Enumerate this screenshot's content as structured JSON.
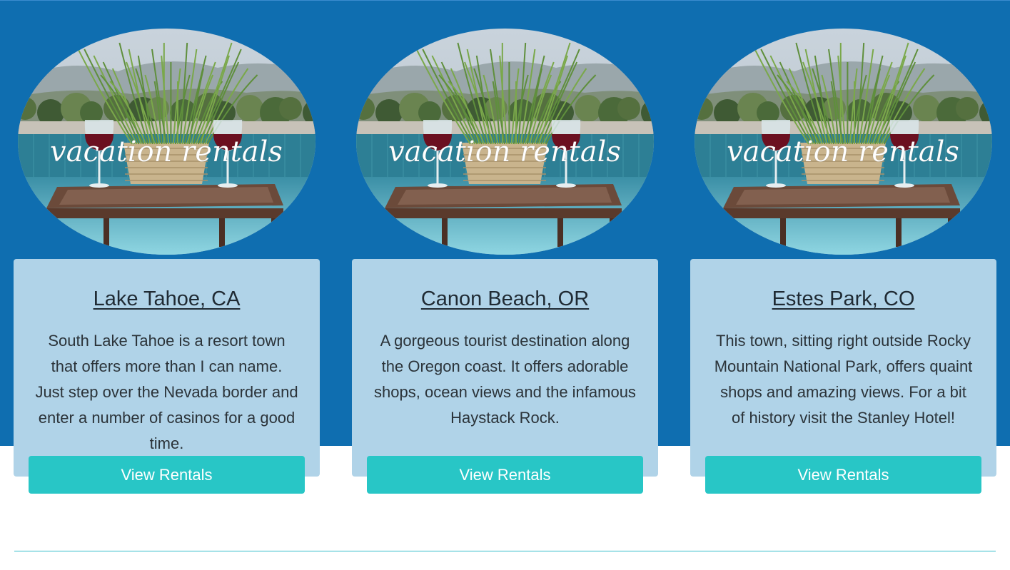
{
  "photo_overlay_text": "vacation rentals",
  "colors": {
    "band": "#0f6eb0",
    "card": "#b0d3e8",
    "button": "#28c6c6",
    "divider": "#31bcc9"
  },
  "destinations": [
    {
      "title": "Lake Tahoe, CA",
      "description": "South Lake Tahoe is a resort town that offers more than I can name. Just step over the Nevada border and enter a number of casinos for a good time.",
      "button_label": "View Rentals"
    },
    {
      "title": "Canon Beach, OR",
      "description": "A gorgeous tourist destination along the Oregon coast. It offers adorable shops, ocean views and the infamous Haystack Rock.",
      "button_label": "View Rentals"
    },
    {
      "title": "Estes Park, CO",
      "description": "This town, sitting right outside Rocky Mountain National Park, offers quaint shops and amazing views. For a bit of history visit the Stanley Hotel!",
      "button_label": "View Rentals"
    }
  ]
}
